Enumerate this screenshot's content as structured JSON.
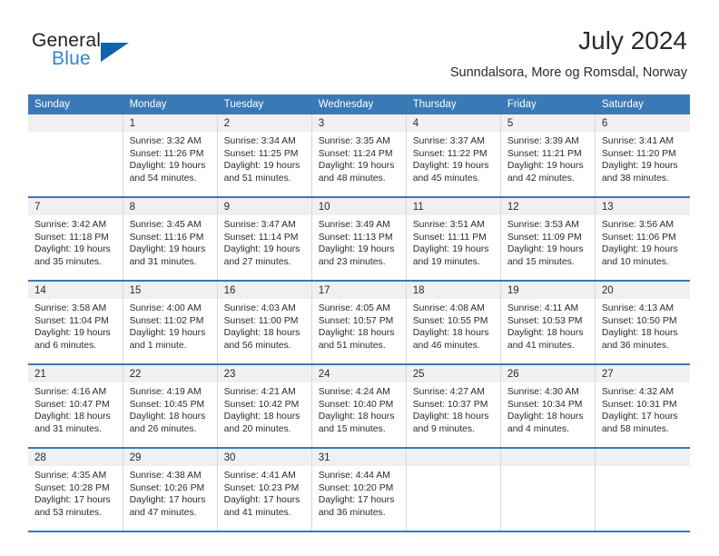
{
  "logo": {
    "text_top": "General",
    "text_bottom": "Blue",
    "triangle_color": "#1263ad",
    "blue_color": "#2f86d4"
  },
  "header": {
    "title": "July 2024",
    "subtitle": "Sunndalsora, More og Romsdal, Norway"
  },
  "theme": {
    "header_bg": "#3a79b6",
    "daynum_bg": "#f0f0f0",
    "cell_bg": "#ffffff",
    "text": "#2b2b2b"
  },
  "calendar": {
    "weekday_headers": [
      "Sunday",
      "Monday",
      "Tuesday",
      "Wednesday",
      "Thursday",
      "Friday",
      "Saturday"
    ],
    "weeks": [
      [
        {
          "day": "",
          "sunrise": "",
          "sunset": "",
          "daylight1": "",
          "daylight2": ""
        },
        {
          "day": "1",
          "sunrise": "Sunrise: 3:32 AM",
          "sunset": "Sunset: 11:26 PM",
          "daylight1": "Daylight: 19 hours",
          "daylight2": "and 54 minutes."
        },
        {
          "day": "2",
          "sunrise": "Sunrise: 3:34 AM",
          "sunset": "Sunset: 11:25 PM",
          "daylight1": "Daylight: 19 hours",
          "daylight2": "and 51 minutes."
        },
        {
          "day": "3",
          "sunrise": "Sunrise: 3:35 AM",
          "sunset": "Sunset: 11:24 PM",
          "daylight1": "Daylight: 19 hours",
          "daylight2": "and 48 minutes."
        },
        {
          "day": "4",
          "sunrise": "Sunrise: 3:37 AM",
          "sunset": "Sunset: 11:22 PM",
          "daylight1": "Daylight: 19 hours",
          "daylight2": "and 45 minutes."
        },
        {
          "day": "5",
          "sunrise": "Sunrise: 3:39 AM",
          "sunset": "Sunset: 11:21 PM",
          "daylight1": "Daylight: 19 hours",
          "daylight2": "and 42 minutes."
        },
        {
          "day": "6",
          "sunrise": "Sunrise: 3:41 AM",
          "sunset": "Sunset: 11:20 PM",
          "daylight1": "Daylight: 19 hours",
          "daylight2": "and 38 minutes."
        }
      ],
      [
        {
          "day": "7",
          "sunrise": "Sunrise: 3:42 AM",
          "sunset": "Sunset: 11:18 PM",
          "daylight1": "Daylight: 19 hours",
          "daylight2": "and 35 minutes."
        },
        {
          "day": "8",
          "sunrise": "Sunrise: 3:45 AM",
          "sunset": "Sunset: 11:16 PM",
          "daylight1": "Daylight: 19 hours",
          "daylight2": "and 31 minutes."
        },
        {
          "day": "9",
          "sunrise": "Sunrise: 3:47 AM",
          "sunset": "Sunset: 11:14 PM",
          "daylight1": "Daylight: 19 hours",
          "daylight2": "and 27 minutes."
        },
        {
          "day": "10",
          "sunrise": "Sunrise: 3:49 AM",
          "sunset": "Sunset: 11:13 PM",
          "daylight1": "Daylight: 19 hours",
          "daylight2": "and 23 minutes."
        },
        {
          "day": "11",
          "sunrise": "Sunrise: 3:51 AM",
          "sunset": "Sunset: 11:11 PM",
          "daylight1": "Daylight: 19 hours",
          "daylight2": "and 19 minutes."
        },
        {
          "day": "12",
          "sunrise": "Sunrise: 3:53 AM",
          "sunset": "Sunset: 11:09 PM",
          "daylight1": "Daylight: 19 hours",
          "daylight2": "and 15 minutes."
        },
        {
          "day": "13",
          "sunrise": "Sunrise: 3:56 AM",
          "sunset": "Sunset: 11:06 PM",
          "daylight1": "Daylight: 19 hours",
          "daylight2": "and 10 minutes."
        }
      ],
      [
        {
          "day": "14",
          "sunrise": "Sunrise: 3:58 AM",
          "sunset": "Sunset: 11:04 PM",
          "daylight1": "Daylight: 19 hours",
          "daylight2": "and 6 minutes."
        },
        {
          "day": "15",
          "sunrise": "Sunrise: 4:00 AM",
          "sunset": "Sunset: 11:02 PM",
          "daylight1": "Daylight: 19 hours",
          "daylight2": "and 1 minute."
        },
        {
          "day": "16",
          "sunrise": "Sunrise: 4:03 AM",
          "sunset": "Sunset: 11:00 PM",
          "daylight1": "Daylight: 18 hours",
          "daylight2": "and 56 minutes."
        },
        {
          "day": "17",
          "sunrise": "Sunrise: 4:05 AM",
          "sunset": "Sunset: 10:57 PM",
          "daylight1": "Daylight: 18 hours",
          "daylight2": "and 51 minutes."
        },
        {
          "day": "18",
          "sunrise": "Sunrise: 4:08 AM",
          "sunset": "Sunset: 10:55 PM",
          "daylight1": "Daylight: 18 hours",
          "daylight2": "and 46 minutes."
        },
        {
          "day": "19",
          "sunrise": "Sunrise: 4:11 AM",
          "sunset": "Sunset: 10:53 PM",
          "daylight1": "Daylight: 18 hours",
          "daylight2": "and 41 minutes."
        },
        {
          "day": "20",
          "sunrise": "Sunrise: 4:13 AM",
          "sunset": "Sunset: 10:50 PM",
          "daylight1": "Daylight: 18 hours",
          "daylight2": "and 36 minutes."
        }
      ],
      [
        {
          "day": "21",
          "sunrise": "Sunrise: 4:16 AM",
          "sunset": "Sunset: 10:47 PM",
          "daylight1": "Daylight: 18 hours",
          "daylight2": "and 31 minutes."
        },
        {
          "day": "22",
          "sunrise": "Sunrise: 4:19 AM",
          "sunset": "Sunset: 10:45 PM",
          "daylight1": "Daylight: 18 hours",
          "daylight2": "and 26 minutes."
        },
        {
          "day": "23",
          "sunrise": "Sunrise: 4:21 AM",
          "sunset": "Sunset: 10:42 PM",
          "daylight1": "Daylight: 18 hours",
          "daylight2": "and 20 minutes."
        },
        {
          "day": "24",
          "sunrise": "Sunrise: 4:24 AM",
          "sunset": "Sunset: 10:40 PM",
          "daylight1": "Daylight: 18 hours",
          "daylight2": "and 15 minutes."
        },
        {
          "day": "25",
          "sunrise": "Sunrise: 4:27 AM",
          "sunset": "Sunset: 10:37 PM",
          "daylight1": "Daylight: 18 hours",
          "daylight2": "and 9 minutes."
        },
        {
          "day": "26",
          "sunrise": "Sunrise: 4:30 AM",
          "sunset": "Sunset: 10:34 PM",
          "daylight1": "Daylight: 18 hours",
          "daylight2": "and 4 minutes."
        },
        {
          "day": "27",
          "sunrise": "Sunrise: 4:32 AM",
          "sunset": "Sunset: 10:31 PM",
          "daylight1": "Daylight: 17 hours",
          "daylight2": "and 58 minutes."
        }
      ],
      [
        {
          "day": "28",
          "sunrise": "Sunrise: 4:35 AM",
          "sunset": "Sunset: 10:28 PM",
          "daylight1": "Daylight: 17 hours",
          "daylight2": "and 53 minutes."
        },
        {
          "day": "29",
          "sunrise": "Sunrise: 4:38 AM",
          "sunset": "Sunset: 10:26 PM",
          "daylight1": "Daylight: 17 hours",
          "daylight2": "and 47 minutes."
        },
        {
          "day": "30",
          "sunrise": "Sunrise: 4:41 AM",
          "sunset": "Sunset: 10:23 PM",
          "daylight1": "Daylight: 17 hours",
          "daylight2": "and 41 minutes."
        },
        {
          "day": "31",
          "sunrise": "Sunrise: 4:44 AM",
          "sunset": "Sunset: 10:20 PM",
          "daylight1": "Daylight: 17 hours",
          "daylight2": "and 36 minutes."
        },
        {
          "day": "",
          "sunrise": "",
          "sunset": "",
          "daylight1": "",
          "daylight2": ""
        },
        {
          "day": "",
          "sunrise": "",
          "sunset": "",
          "daylight1": "",
          "daylight2": ""
        },
        {
          "day": "",
          "sunrise": "",
          "sunset": "",
          "daylight1": "",
          "daylight2": ""
        }
      ]
    ]
  }
}
